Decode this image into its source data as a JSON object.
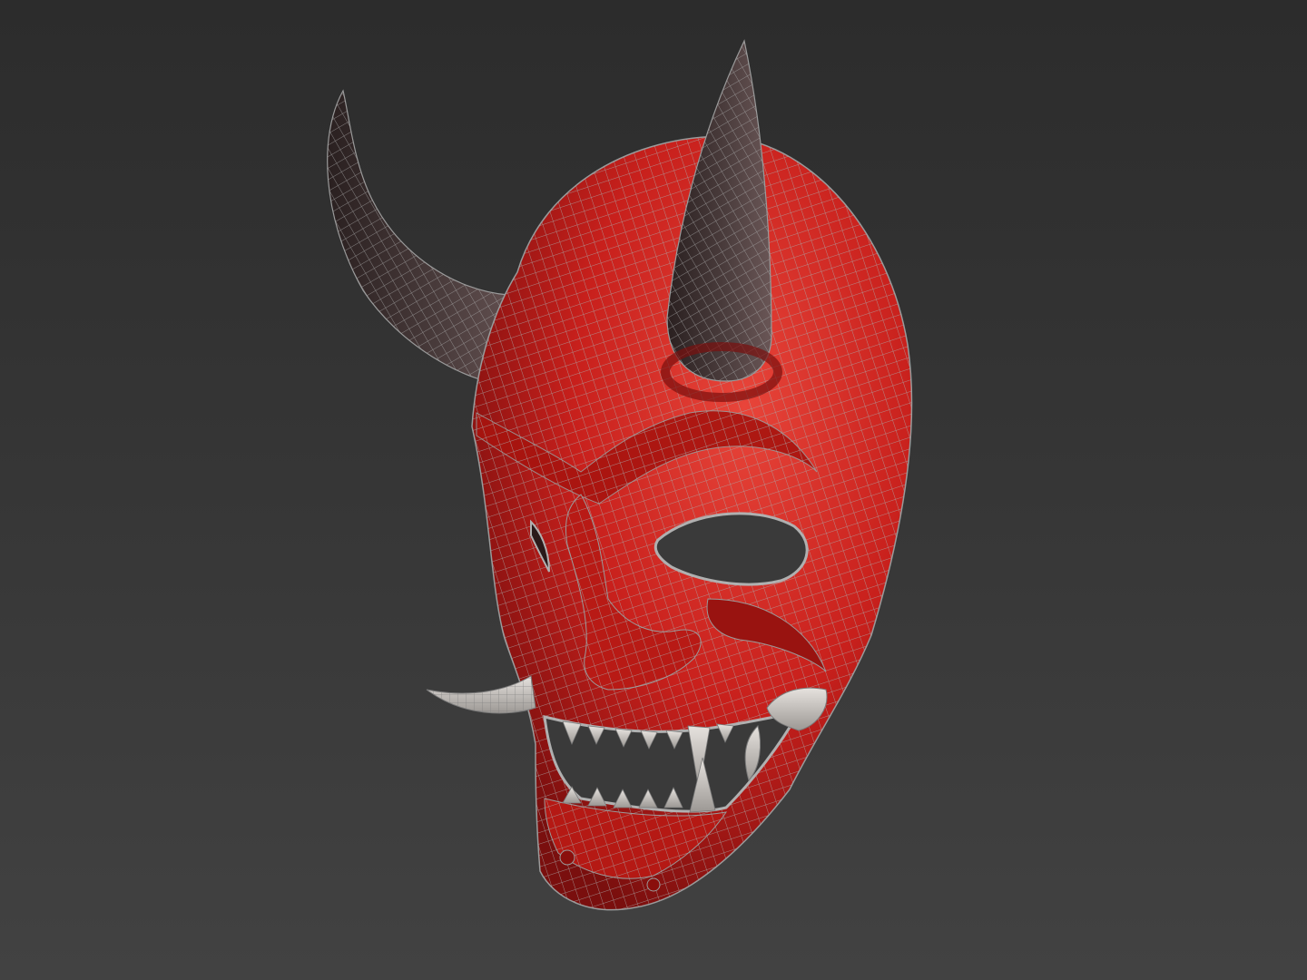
{
  "viewport": {
    "background_top": "#2c2c2c",
    "background_bottom": "#424242"
  },
  "model": {
    "subject": "oni-mask-wireframe",
    "colors": {
      "face": "#c8201c",
      "face_shadow": "#7a0f0e",
      "face_highlight": "#e8453a",
      "horn": "#3a2e2e",
      "horn_highlight": "#6a5656",
      "teeth": "#d8d4d0",
      "teeth_shadow": "#8c8884",
      "wire": "#9a9a9a",
      "eye_hole": "#3a3a3a"
    }
  }
}
